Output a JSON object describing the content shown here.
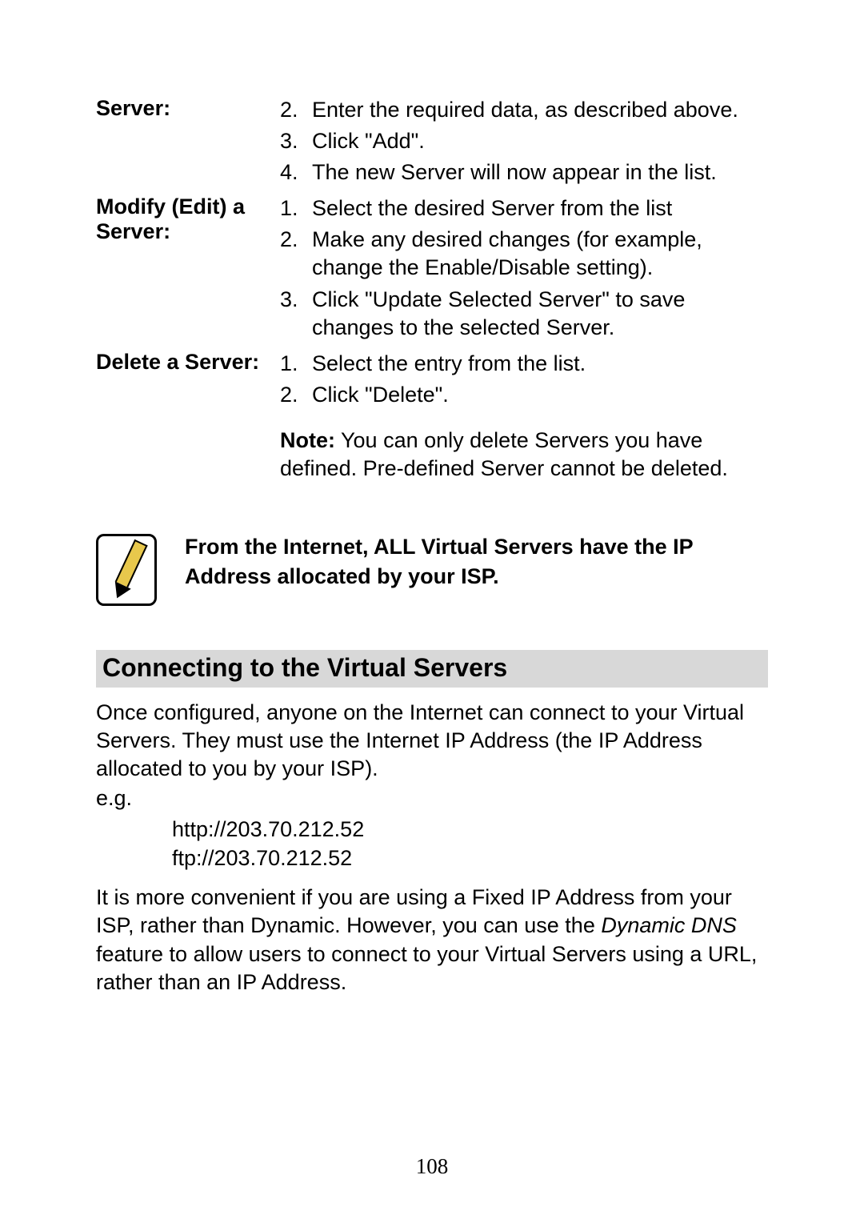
{
  "defs": {
    "server": {
      "label": "Server:",
      "items": [
        {
          "num": "2.",
          "text": "Enter the required data, as described above."
        },
        {
          "num": "3.",
          "text": "Click \"Add\"."
        },
        {
          "num": "4.",
          "text": "The new Server will now appear in the list."
        }
      ]
    },
    "modify": {
      "label": "Modify (Edit) a Server:",
      "items": [
        {
          "num": "1.",
          "text": "Select the desired Server from the list"
        },
        {
          "num": "2.",
          "text": "Make any desired changes (for example, change the Enable/Disable setting)."
        },
        {
          "num": "3.",
          "text": "Click \"Update Selected Server\" to save changes to the selected Server."
        }
      ]
    },
    "delete": {
      "label": "Delete a Server:",
      "items": [
        {
          "num": "1.",
          "text": "Select the entry from the list."
        },
        {
          "num": "2.",
          "text": "Click \"Delete\"."
        }
      ],
      "note_label": "Note:",
      "note_text": "  You can only delete Servers you have defined. Pre-defined Server cannot be deleted."
    }
  },
  "callout": "From the Internet, ALL Virtual Servers have the IP Address allocated by your ISP.",
  "heading": "Connecting to the Virtual Servers",
  "para1": "Once configured, anyone on the Internet can connect to your Virtual Servers. They must use the Internet IP Address (the IP Address allocated to you by your ISP).",
  "eg_label": "e.g.",
  "example1": "http://203.70.212.52",
  "example2": "ftp://203.70.212.52",
  "para2_a": "It is more convenient if you are using a Fixed IP Address from your ISP, rather than Dynamic.  However, you can use the ",
  "para2_i": "Dynamic DNS",
  "para2_b": " feature to allow users to connect to your Virtual Servers using a URL, rather than an IP Address.",
  "page_number": "108"
}
